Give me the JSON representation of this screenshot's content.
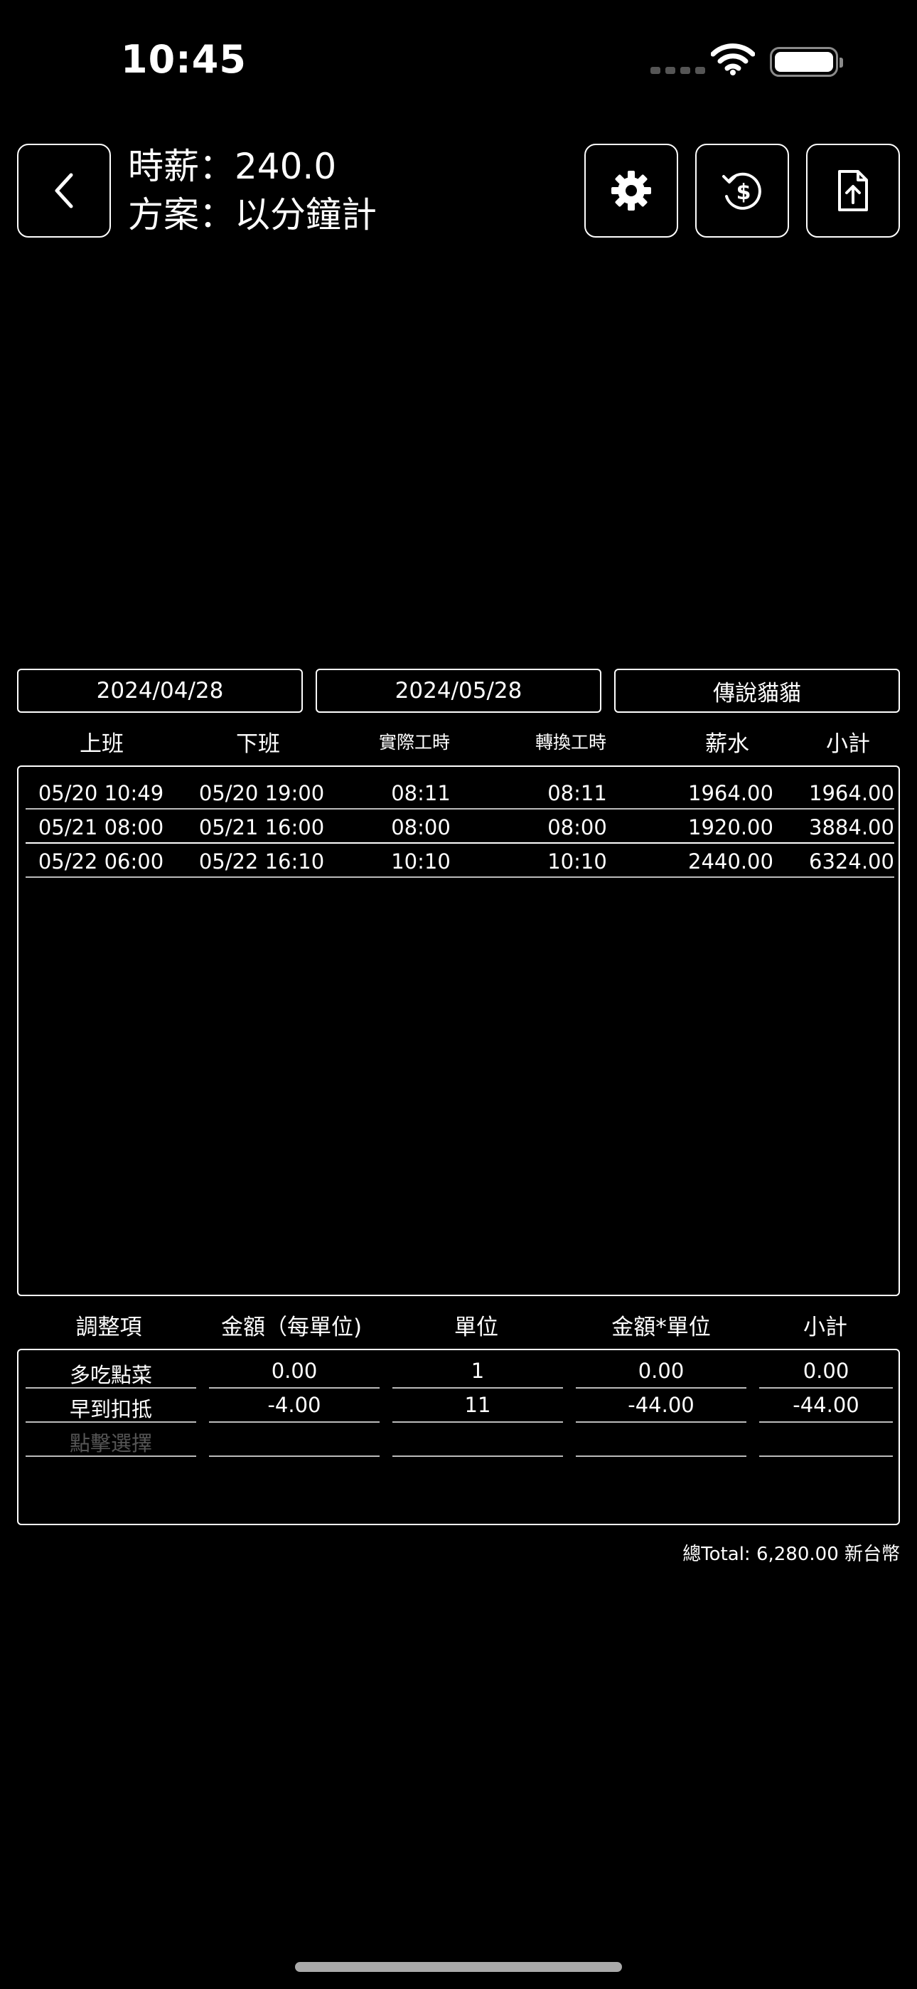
{
  "status_bar": {
    "time": "10:45"
  },
  "header": {
    "wage_line": "時薪：240.0",
    "plan_line": "方案：以分鐘計",
    "icons": {
      "back": "chevron-left-icon",
      "settings": "gear-icon",
      "currency": "currency-refresh-icon",
      "export": "file-upload-icon"
    }
  },
  "filters": {
    "start_date": "2024/04/28",
    "end_date": "2024/05/28",
    "employee": "傳說貓貓"
  },
  "records": {
    "columns": [
      "上班",
      "下班",
      "實際工時",
      "轉換工時",
      "薪水",
      "小計"
    ],
    "rows": [
      {
        "clock_in": "05/20 10:49",
        "clock_out": "05/20 19:00",
        "actual": "08:11",
        "converted": "08:11",
        "pay": "1964.00",
        "subtotal": "1964.00"
      },
      {
        "clock_in": "05/21 08:00",
        "clock_out": "05/21 16:00",
        "actual": "08:00",
        "converted": "08:00",
        "pay": "1920.00",
        "subtotal": "3884.00"
      },
      {
        "clock_in": "05/22 06:00",
        "clock_out": "05/22 16:10",
        "actual": "10:10",
        "converted": "10:10",
        "pay": "2440.00",
        "subtotal": "6324.00"
      }
    ]
  },
  "adjustments": {
    "columns": [
      "調整項",
      "金額（每單位)",
      "單位",
      "金額*單位",
      "小計"
    ],
    "rows": [
      {
        "item": "多吃點菜",
        "amount": "0.00",
        "units": "1",
        "total": "0.00",
        "subtotal": "0.00"
      },
      {
        "item": "早到扣抵",
        "amount": "-4.00",
        "units": "11",
        "total": "-44.00",
        "subtotal": "-44.00"
      }
    ],
    "placeholder": "點擊選擇"
  },
  "summary": {
    "total": "總Total: 6,280.00 新台幣"
  },
  "colors": {
    "background": "#000000",
    "foreground": "#ffffff",
    "placeholder": "#555555"
  }
}
